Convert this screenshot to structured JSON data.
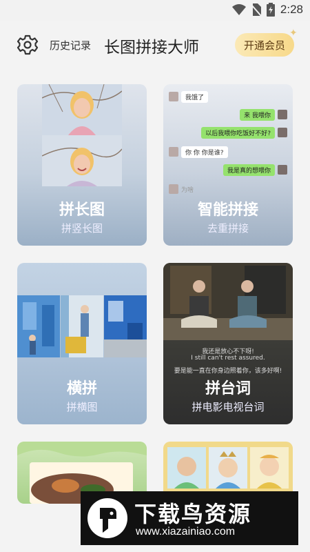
{
  "status_bar": {
    "time": "2:28"
  },
  "header": {
    "history_label": "历史记录",
    "title": "长图拼接大师",
    "vip_label": "开通会员"
  },
  "cards": [
    {
      "title": "拼长图",
      "subtitle": "拼竖长图"
    },
    {
      "title": "智能拼接",
      "subtitle": "去重拼接"
    },
    {
      "title": "横拼",
      "subtitle": "拼横图"
    },
    {
      "title": "拼台词",
      "subtitle": "拼电影电视台词"
    }
  ],
  "chat_preview": [
    {
      "side": "left",
      "text": "我饿了"
    },
    {
      "side": "right",
      "text": "来 我喂你"
    },
    {
      "side": "right",
      "text": "以后我喂你吃饭好不好?"
    },
    {
      "side": "left",
      "text": "你 你 你是谁?"
    },
    {
      "side": "right",
      "text": "我是真的想喂你"
    },
    {
      "side": "left",
      "text": "为啥"
    }
  ],
  "subtitle_preview": {
    "line1": "我还是放心不下呀!",
    "line2": "I still can't rest assured.",
    "line3": "要是能一直在你身边照着你，该多好啊!"
  },
  "watermark": {
    "brand": "下载鸟资源",
    "url": "www.xiazainiao.com"
  }
}
